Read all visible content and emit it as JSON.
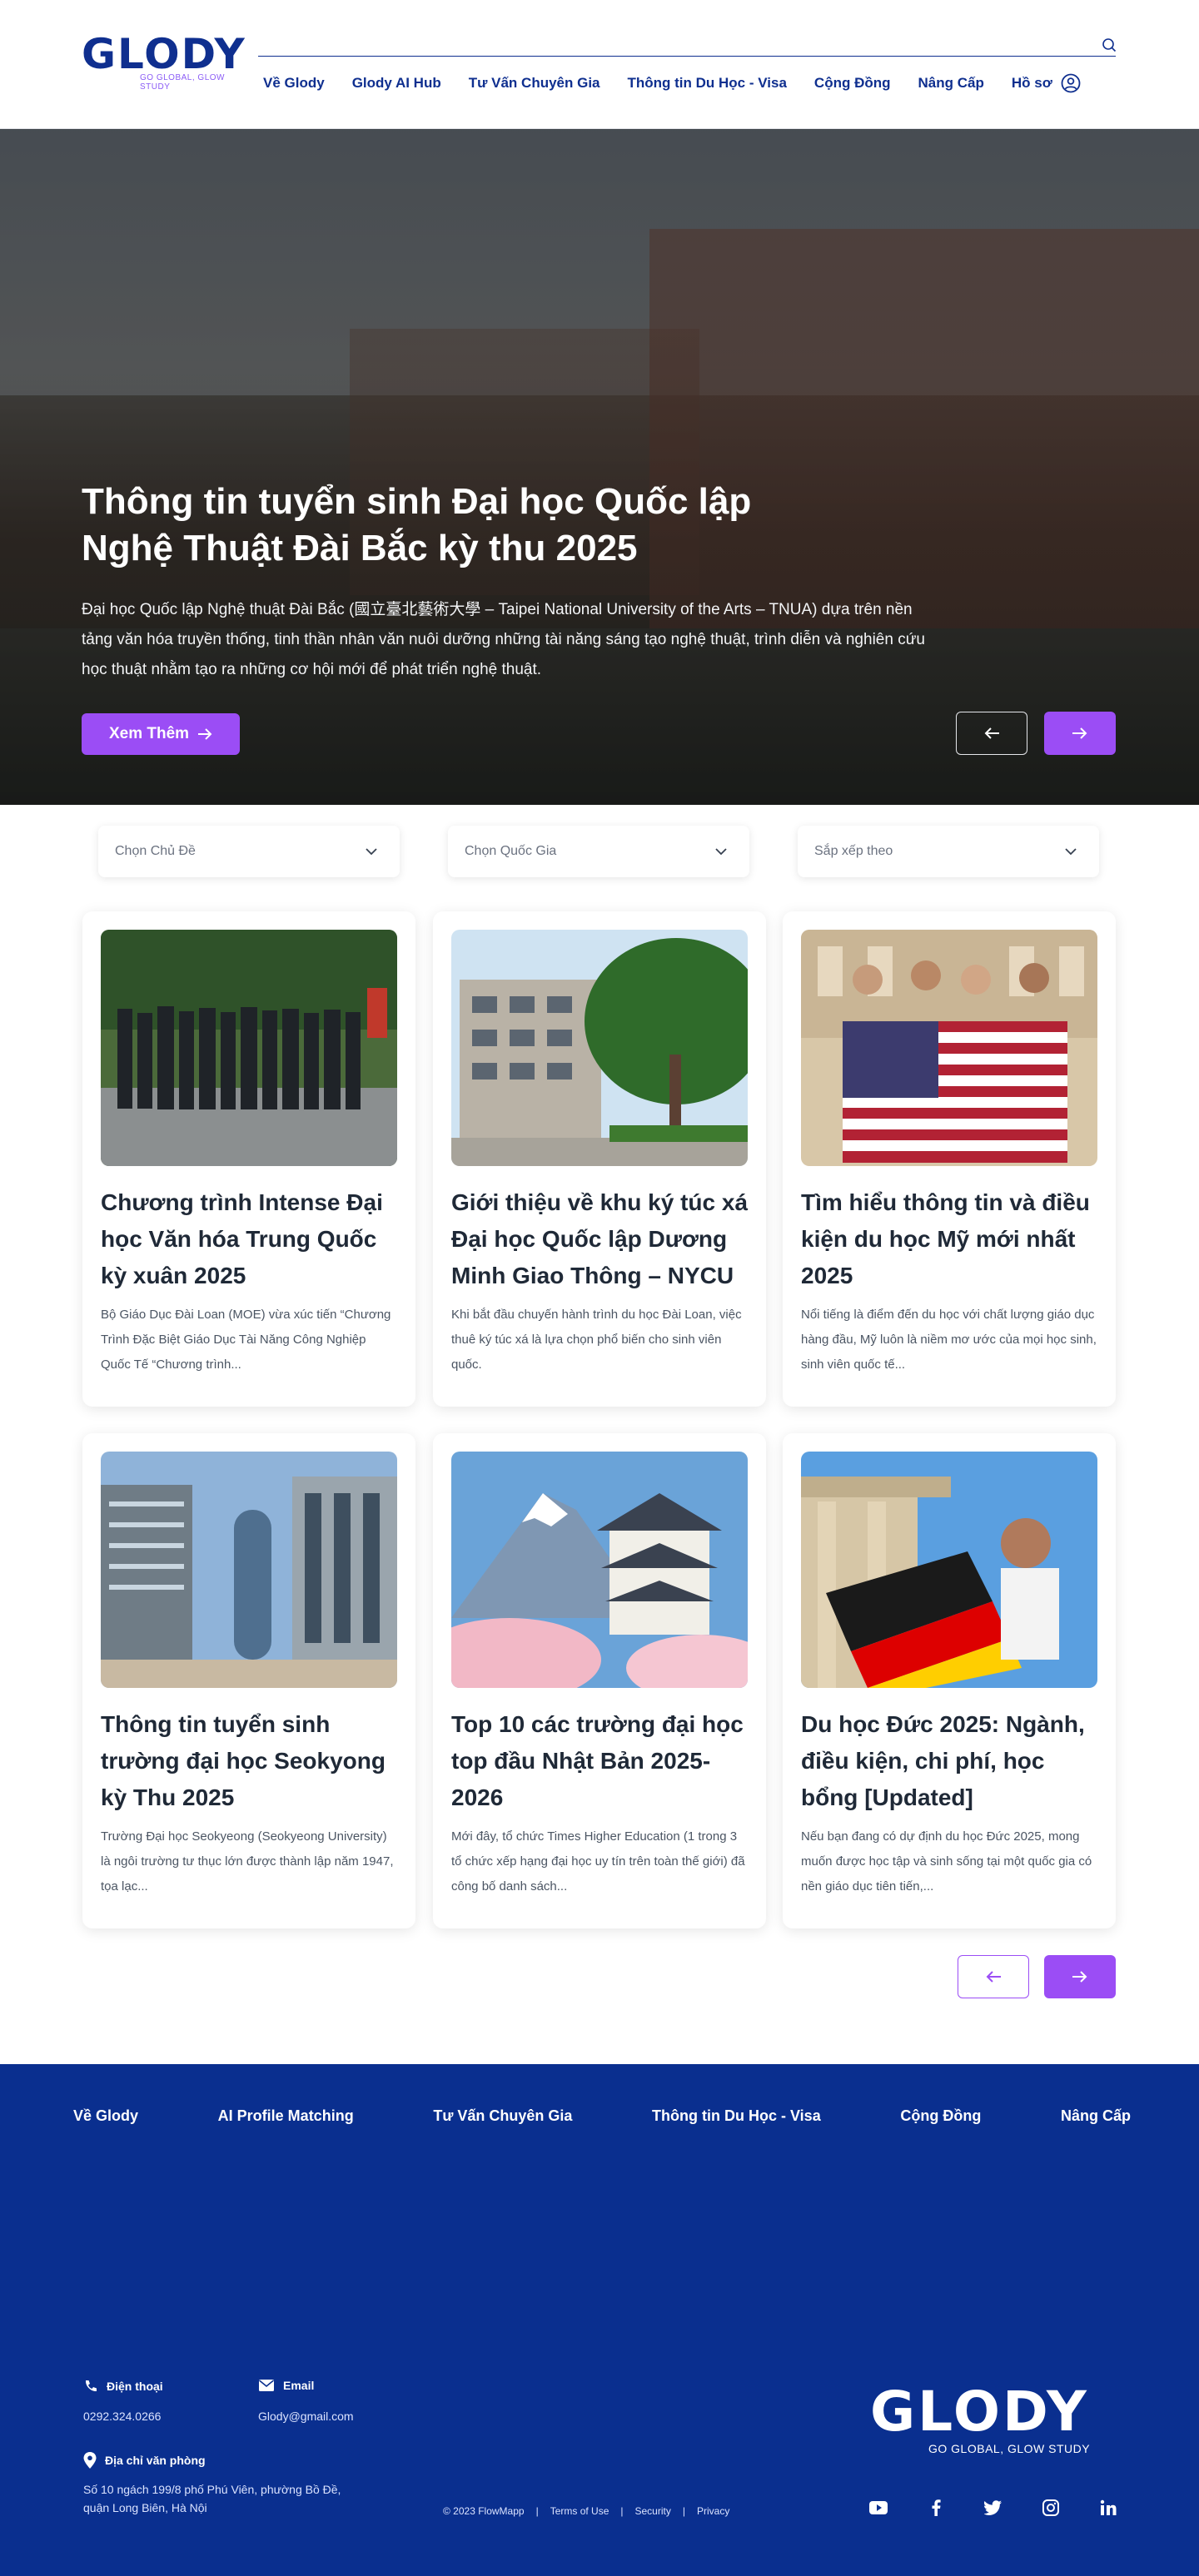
{
  "brand": {
    "logo_text": "GLODY",
    "tagline": "GO GLOBAL, GLOW STUDY",
    "primary_color": "#0f2f8f",
    "accent_color": "#9b4df5"
  },
  "nav": {
    "items": [
      "Về Glody",
      "Glody AI Hub",
      "Tư Vấn Chuyên Gia",
      "Thông tin Du Học - Visa",
      "Cộng Đồng",
      "Nâng Cấp",
      "Hồ sơ"
    ]
  },
  "hero": {
    "title": "Thông tin tuyển sinh Đại học Quốc lập Nghệ Thuật Đài Bắc kỳ thu 2025",
    "description": "Đại học Quốc lập Nghệ thuật Đài Bắc (國立臺北藝術大學 – Taipei National University of the Arts – TNUA) dựa trên nền tảng văn hóa truyền thống, tinh thần nhân văn nuôi dưỡng những tài năng sáng tạo nghệ thuật, trình diễn và nghiên cứu học thuật nhằm tạo ra những cơ hội mới để phát triển nghệ thuật.",
    "cta_label": "Xem Thêm"
  },
  "filters": [
    "Chọn Chủ Đề",
    "Chọn Quốc Gia",
    "Sắp xếp theo"
  ],
  "articles": [
    {
      "title": "Chương trình Intense Đại học Văn hóa Trung Quốc kỳ xuân 2025",
      "excerpt": "Bộ Giáo Dục Đài Loan (MOE) vừa xúc tiến “Chương Trình Đặc Biệt Giáo Dục Tài Năng Công Nghiệp Quốc Tế “Chương trình..."
    },
    {
      "title": "Giới thiệu về khu ký túc xá Đại học Quốc lập Dương Minh Giao Thông – NYCU",
      "excerpt": "Khi bắt đầu chuyến hành trình du học Đài Loan, việc thuê ký túc xá là lựa chọn phổ biến cho sinh viên quốc."
    },
    {
      "title": "Tìm hiểu thông tin và điều kiện du học Mỹ mới nhất 2025",
      "excerpt": "Nổi tiếng là điểm đến du học với chất lượng giáo dục hàng đầu, Mỹ luôn là niềm mơ ước của mọi học sinh, sinh viên quốc tế..."
    },
    {
      "title": "Thông tin tuyển sinh trường đại học Seokyong kỳ Thu 2025",
      "excerpt": "Trường Đại học Seokyeong (Seokyeong University) là ngôi trường tư thục lớn được thành lập năm 1947, tọa lạc..."
    },
    {
      "title": "Top 10 các trường đại học top đầu Nhật Bản 2025-2026",
      "excerpt": "Mới đây, tổ chức Times Higher Education (1 trong 3 tổ chức xếp hạng đại học uy tín trên toàn thế giới) đã công bố danh sách..."
    },
    {
      "title": "Du học Đức 2025: Ngành, điều kiện, chi phí, học bổng [Updated]",
      "excerpt": "Nếu bạn đang có dự định du học Đức 2025, mong muốn được học tập và sinh sống tại một quốc gia có nền giáo dục tiên tiến,..."
    }
  ],
  "footer": {
    "nav": [
      "Về Glody",
      "AI Profile Matching",
      "Tư Vấn Chuyên Gia",
      "Thông tin Du Học - Visa",
      "Cộng Đồng",
      "Nâng Cấp"
    ],
    "phone_label": "Điện thoại",
    "phone_value": "0292.324.0266",
    "email_label": "Email",
    "email_value": "Glody@gmail.com",
    "address_label": "Địa chỉ văn phòng",
    "address_value": "Số 10 ngách 199/8 phố Phú Viên, phường Bồ Đề, quận Long Biên, Hà Nội",
    "logo_text": "GLODY",
    "tagline": "GO GLOBAL, GLOW STUDY",
    "copyright": "© 2023 FlowMapp",
    "legal": [
      "Terms of Use",
      "Security",
      "Privacy"
    ],
    "social_icons": [
      "youtube-icon",
      "facebook-icon",
      "twitter-icon",
      "instagram-icon",
      "linkedin-icon"
    ]
  }
}
